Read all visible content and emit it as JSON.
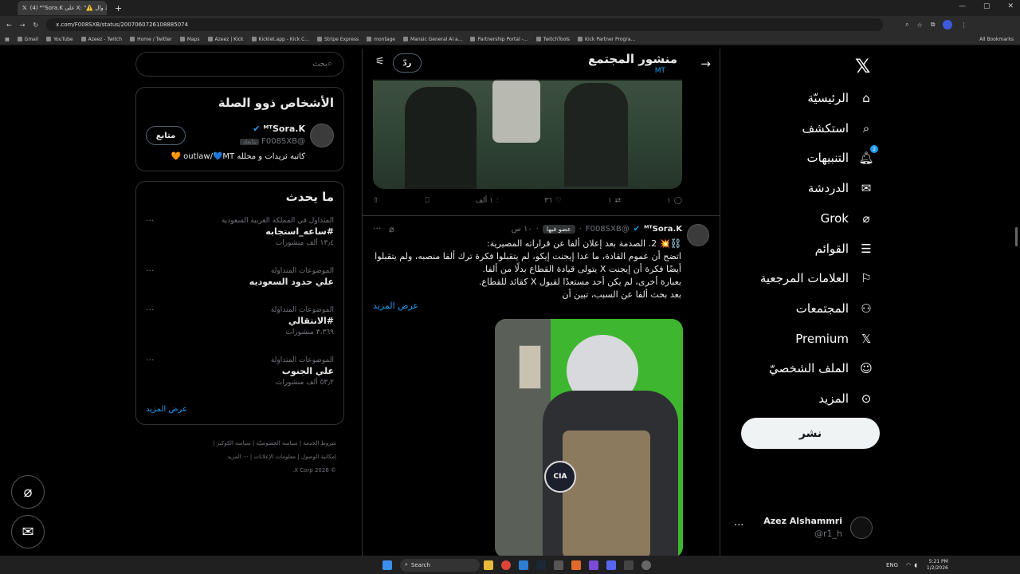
{
  "browser": {
    "tab_title": "(4) ᴹᵀSora.K على X: \"⚠️ الحط وال...",
    "url": "x.com/F008SXB/status/2007060726108885074",
    "bookmarks": [
      "Gmail",
      "YouTube",
      "Azeez - Twitch",
      "Home / Twitter",
      "Maps",
      "Azeez | Kick",
      "Kicklet.app - Kick C...",
      "Stripe Express",
      "montage",
      "Mansic General AI a...",
      "Partnership Portal -...",
      "TwitchTools",
      "Kick Partner Progra..."
    ],
    "all_bookmarks": "All Bookmarks"
  },
  "nav": {
    "items": [
      {
        "label": "الرئيسيّة",
        "icon": "home-icon"
      },
      {
        "label": "استكشف",
        "icon": "search-icon"
      },
      {
        "label": "التنبيهات",
        "icon": "bell-icon",
        "badge": "2"
      },
      {
        "label": "الدردشة",
        "icon": "mail-icon"
      },
      {
        "label": "Grok",
        "icon": "grok-icon"
      },
      {
        "label": "القوائم",
        "icon": "list-icon"
      },
      {
        "label": "العلامات المرجعية",
        "icon": "bookmark-icon"
      },
      {
        "label": "المجتمعات",
        "icon": "communities-icon"
      },
      {
        "label": "Premium",
        "icon": "x-icon"
      },
      {
        "label": "الملف الشخصيّ",
        "icon": "person-icon"
      },
      {
        "label": "المزيد",
        "icon": "more-circle-icon"
      }
    ],
    "post_button": "نشر",
    "account": {
      "name": "Azez Alshammri",
      "handle": "@r1_h"
    }
  },
  "header": {
    "title": "منشور المجتمع",
    "subtitle": "MT",
    "reply_button": "ردّ"
  },
  "prev_tweet_actions": {
    "replies": "١",
    "retweets": "١",
    "likes": "٣٦",
    "views": "١ ألف"
  },
  "tweet": {
    "name": "ᴹᵀSora.K",
    "handle": "@F008SXB",
    "member_badge": "عضو فيها",
    "time": "١٠ س",
    "lines": [
      "⛓️💥 2. الصدمة بعد إعلان ألفا عن قراراته المصيرية:",
      "اتضح أن عموم القادة، ما عدا إيجنت إيكو، لم يتقبلوا فكرة ترك ألفا منصبه، ولم يتقبلوا",
      "أيضًا فكرة أن إيجنت X يتولى قيادة القطاع بدلًا من ألفا.",
      "بعبارة أخرى، لم يكن أحد مستعدًا لقبول X كقائد للقطاع.",
      "بعد بحث ألفا عن السبب، تبين أن"
    ],
    "show_more": "عرض المزيد",
    "image_badge": "CIA"
  },
  "sidebar": {
    "search_placeholder": "بحث",
    "related": {
      "title": "الأشخاص ذوو الصلة",
      "name": "ᴹᵀSora.K",
      "handle": "@F008SXB",
      "follows_badge": "يتابعك",
      "follow_button": "متابع",
      "bio": "كاتبه ثريدات و محلله outlaw/💙MT 🧡"
    },
    "trends": {
      "title": "ما يحدث",
      "items": [
        {
          "meta": "المتداول في المملكة العربية السعودية",
          "name": "#ساعه_استجابه",
          "count": "١٣٫٤ ألف منشورات"
        },
        {
          "meta": "الموضوعات المتداولة",
          "name": "علي حدود السعوديه",
          "count": ""
        },
        {
          "meta": "الموضوعات المتداولة",
          "name": "#الانتقالي",
          "count": "٣،٣٦٩ منشورات"
        },
        {
          "meta": "الموضوعات المتداولة",
          "name": "علي الجنوب",
          "count": "٥٣٫٢ ألف منشورات"
        }
      ],
      "show_more": "عرض المزيد"
    },
    "footer": {
      "line1": "شروط الخدمة | سياسة الخصوصيّة | سياسة الكوكيز |",
      "line2": "إمكانية الوصول | معلومات الإعلانات | ··· المزيد",
      "copyright": "© 2026 X Corp."
    }
  },
  "taskbar": {
    "search": "Search",
    "lang": "ENG",
    "time": "5:21 PM",
    "date": "1/2/2026"
  },
  "colors": {
    "accent": "#1d9bf0",
    "background": "#000000",
    "border": "#2f3336"
  }
}
